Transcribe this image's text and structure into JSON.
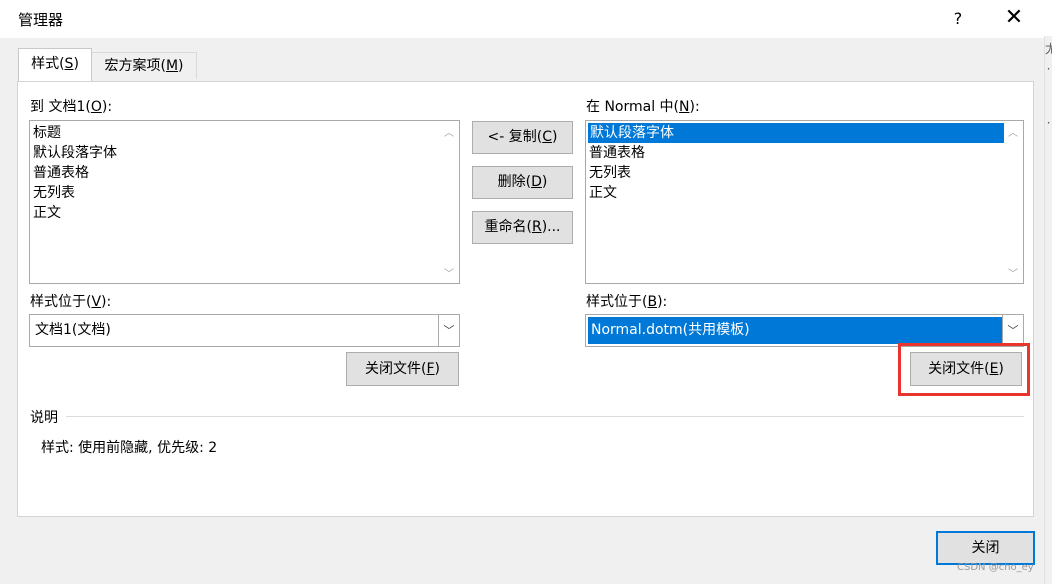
{
  "window": {
    "title": "管理器",
    "help_label": "?",
    "close_glyph": "✕"
  },
  "tabs": [
    {
      "label": "样式(",
      "key": "S",
      "suffix": ")"
    },
    {
      "label": "宏方案项(",
      "key": "M",
      "suffix": ")"
    }
  ],
  "left": {
    "list_label": "到 文档1(",
    "list_key": "O",
    "list_suffix": "):",
    "items": [
      "标题",
      "默认段落字体",
      "普通表格",
      "无列表",
      "正文"
    ],
    "location_label": "样式位于(",
    "location_key": "V",
    "location_suffix": "):",
    "location_value": "文档1(文档)",
    "close_file_label": "关闭文件(",
    "close_file_key": "F",
    "close_file_suffix": ")"
  },
  "middle": {
    "copy_label": "<- 复制(",
    "copy_key": "C",
    "copy_suffix": ")",
    "delete_label": "删除(",
    "delete_key": "D",
    "delete_suffix": ")",
    "rename_label": "重命名(",
    "rename_key": "R",
    "rename_suffix": ")..."
  },
  "right": {
    "list_label": "在 Normal 中(",
    "list_key": "N",
    "list_suffix": "):",
    "items": [
      "默认段落字体",
      "普通表格",
      "无列表",
      "正文"
    ],
    "selected_index": 0,
    "location_label": "样式位于(",
    "location_key": "B",
    "location_suffix": "):",
    "location_value": "Normal.dotm(共用模板)",
    "close_file_label": "关闭文件(",
    "close_file_key": "E",
    "close_file_suffix": ")"
  },
  "description": {
    "heading": "说明",
    "text": "样式: 使用前隐藏, 优先级: 2"
  },
  "footer": {
    "close_label": "关闭"
  },
  "watermark": "CSDN @cho_ey",
  "edge_glyphs": [
    "尤",
    "·",
    "「",
    "「",
    "·"
  ],
  "icons": {
    "scroll_up": "chevron-up-icon",
    "scroll_down": "chevron-down-icon",
    "combo": "chevron-down-icon"
  },
  "colors": {
    "selection": "#0078d7",
    "highlight_border": "#e8352d",
    "dialog_bg": "#f0f0f0"
  }
}
